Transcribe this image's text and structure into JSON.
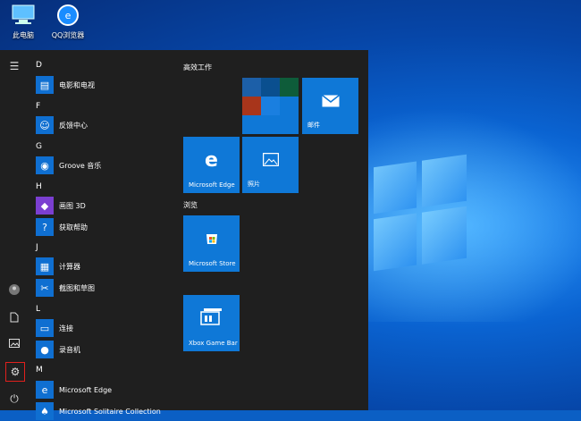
{
  "desktop": {
    "icons": [
      {
        "label": "此电脑",
        "icon": "computer-icon"
      },
      {
        "label": "QQ浏览器",
        "icon": "qq-browser-icon"
      }
    ]
  },
  "start_menu": {
    "app_list": {
      "sections": [
        {
          "letter": "D",
          "apps": [
            {
              "label": "电影和电视",
              "icon": "film-icon"
            }
          ]
        },
        {
          "letter": "F",
          "apps": [
            {
              "label": "反馈中心",
              "icon": "feedback-icon"
            }
          ]
        },
        {
          "letter": "G",
          "apps": [
            {
              "label": "Groove 音乐",
              "icon": "groove-icon"
            }
          ]
        },
        {
          "letter": "H",
          "apps": [
            {
              "label": "画图 3D",
              "icon": "paint3d-icon"
            },
            {
              "label": "获取帮助",
              "icon": "help-icon"
            }
          ]
        },
        {
          "letter": "J",
          "apps": [
            {
              "label": "计算器",
              "icon": "calculator-icon"
            },
            {
              "label": "截图和草图",
              "icon": "snip-icon"
            }
          ]
        },
        {
          "letter": "L",
          "apps": [
            {
              "label": "连接",
              "icon": "connect-icon"
            },
            {
              "label": "录音机",
              "icon": "recorder-icon"
            }
          ]
        },
        {
          "letter": "M",
          "apps": [
            {
              "label": "Microsoft Edge",
              "icon": "edge-icon"
            },
            {
              "label": "Microsoft Solitaire Collection",
              "icon": "solitaire-icon"
            }
          ]
        }
      ]
    },
    "tile_groups": {
      "group1": "高效工作",
      "group2": "浏览"
    },
    "tiles": {
      "mail": "邮件",
      "edge": "Microsoft Edge",
      "photos": "照片",
      "store": "Microsoft Store",
      "xbox": "Xbox Game Bar"
    },
    "rail_icons": [
      "menu-icon",
      "user-icon",
      "document-icon",
      "pictures-icon",
      "settings-icon",
      "power-icon"
    ]
  },
  "colors": {
    "accent": "#0f78d7",
    "menu_bg": "#1f1f1f",
    "highlight": "#e0201d"
  }
}
